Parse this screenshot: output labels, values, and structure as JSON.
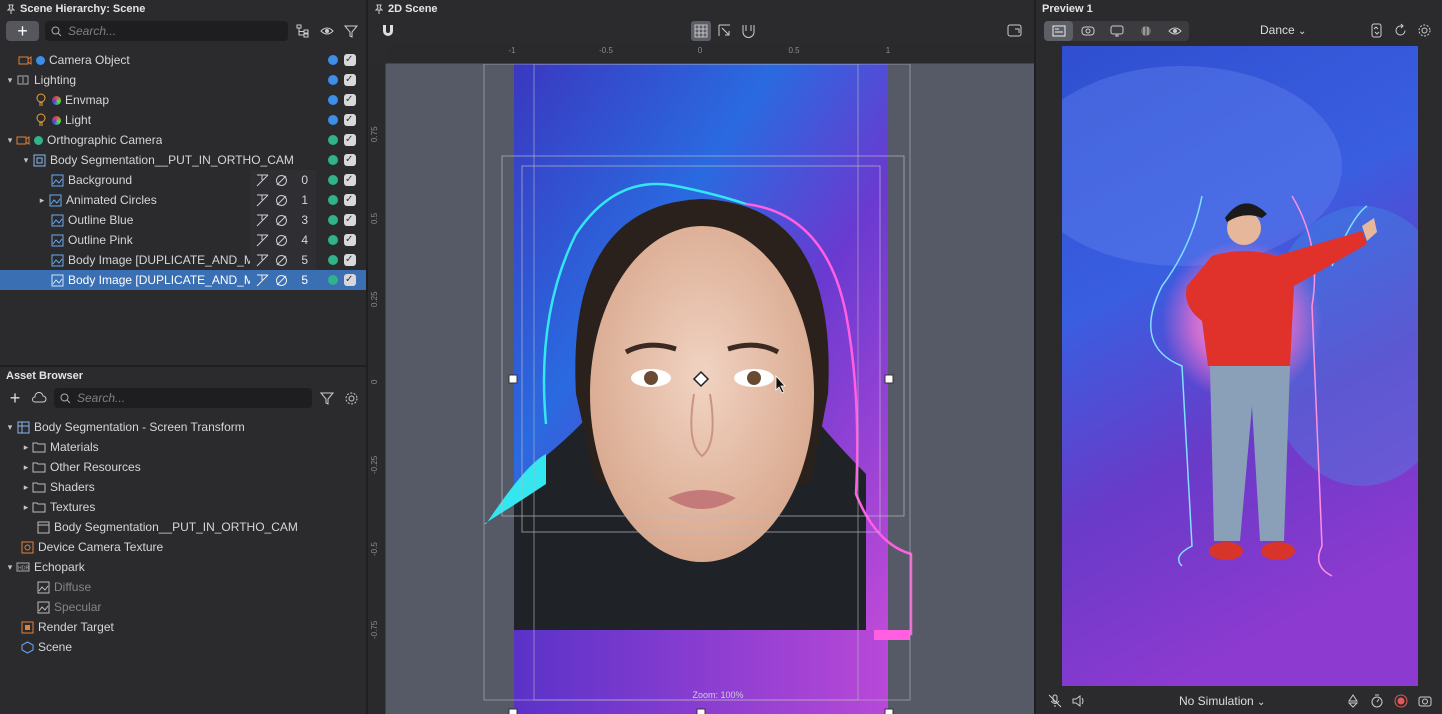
{
  "hierarchy": {
    "title": "Scene Hierarchy: Scene",
    "search_placeholder": "Search...",
    "rows": [
      {
        "label": "Camera Object"
      },
      {
        "label": "Lighting"
      },
      {
        "label": "Envmap"
      },
      {
        "label": "Light"
      },
      {
        "label": "Orthographic Camera"
      },
      {
        "label": "Body Segmentation__PUT_IN_ORTHO_CAM"
      },
      {
        "label": "Background",
        "layer": "0"
      },
      {
        "label": "Animated Circles",
        "layer": "1"
      },
      {
        "label": "Outline Blue",
        "layer": "3"
      },
      {
        "label": "Outline Pink",
        "layer": "4"
      },
      {
        "label": "Body Image [DUPLICATE_AND_MO",
        "layer": "5"
      },
      {
        "label": "Body Image [DUPLICATE_AND_MO",
        "layer": "5"
      }
    ]
  },
  "assets": {
    "title": "Asset Browser",
    "search_placeholder": "Search...",
    "rows": [
      {
        "label": "Body Segmentation - Screen Transform"
      },
      {
        "label": "Materials"
      },
      {
        "label": "Other Resources"
      },
      {
        "label": "Shaders"
      },
      {
        "label": "Textures"
      },
      {
        "label": "Body Segmentation__PUT_IN_ORTHO_CAM"
      },
      {
        "label": "Device Camera Texture"
      },
      {
        "label": "Echopark"
      },
      {
        "label": "Diffuse"
      },
      {
        "label": "Specular"
      },
      {
        "label": "Render Target"
      },
      {
        "label": "Scene"
      }
    ]
  },
  "scene2d": {
    "title": "2D Scene",
    "zoom_label": "Zoom: 100%",
    "ruler_top": [
      "-1",
      "-0.5",
      "0",
      "0.5",
      "1"
    ],
    "ruler_left": [
      "0.75",
      "0.5",
      "0.25",
      "0",
      "-0.25",
      "-0.5",
      "-0.75"
    ]
  },
  "preview": {
    "title": "Preview 1",
    "lens_dropdown": "Dance",
    "simulation_dropdown": "No Simulation"
  },
  "colors": {
    "selection": "#3b6fb3",
    "camera_orange": "#e0823a",
    "dot_blue": "#3d8ee8",
    "dot_green": "#30b38a",
    "cyan_outline": "#33e6f0",
    "pink_outline": "#ff5fe0"
  }
}
